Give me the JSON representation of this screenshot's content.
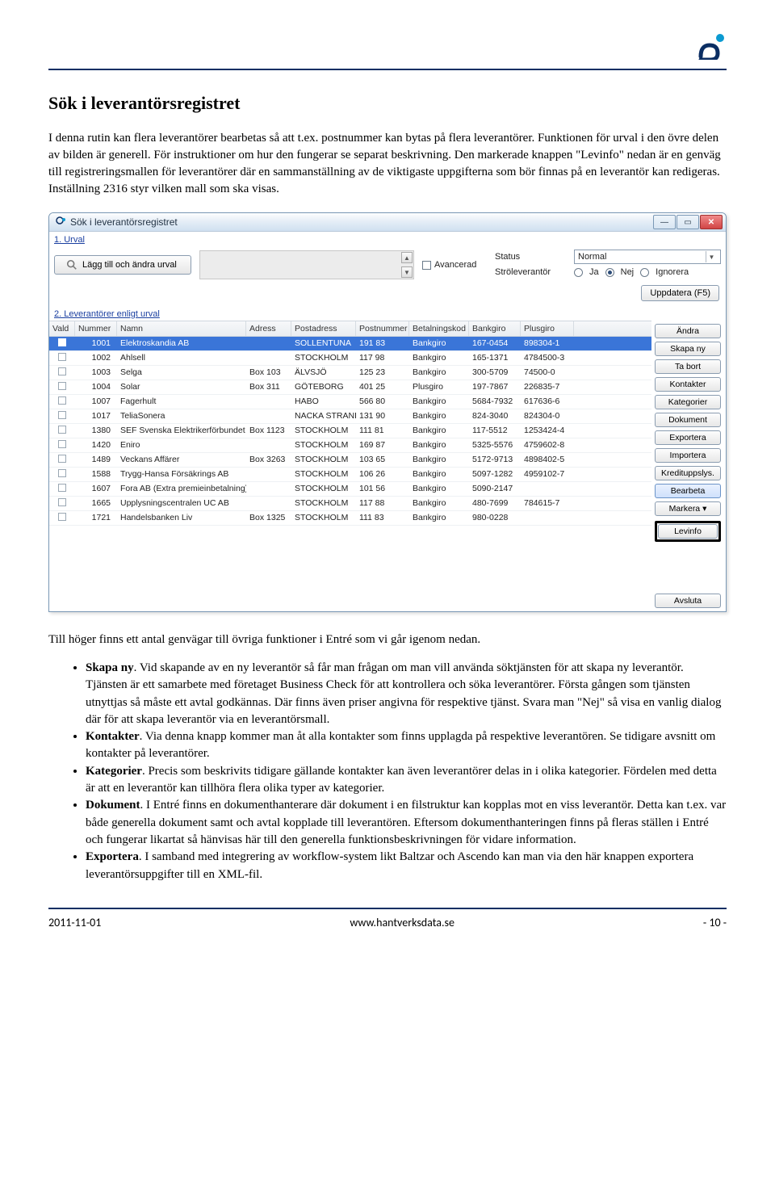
{
  "doc": {
    "section_title": "Sök i leverantörsregistret",
    "para1": "I denna rutin  kan flera leverantörer bearbetas så att t.ex. postnummer kan bytas på flera leverantörer. Funktionen för urval i den övre delen av bilden är generell. För instruktioner om hur den fungerar se separat beskrivning. Den markerade knappen \"Levinfo\" nedan är en genväg till registreringsmallen för leverantörer där en sammanställning av de viktigaste uppgifterna som bör finnas på en leverantör kan redigeras. Inställning 2316 styr vilken mall som ska visas.",
    "para2": "Till höger finns ett antal genvägar till övriga funktioner i Entré som vi går igenom nedan.",
    "bullets": [
      {
        "lead": "Skapa ny",
        "text": ". Vid skapande av en ny leverantör så får man frågan om man vill använda söktjänsten för att skapa ny leverantör. Tjänsten är ett samarbete med företaget Business Check för att kontrollera och söka leverantörer. Första gången som tjänsten utnyttjas så måste ett avtal godkännas. Där finns även priser angivna för respektive tjänst. Svara man \"Nej\" så visa en vanlig dialog där för att skapa leverantör via en leverantörsmall."
      },
      {
        "lead": "Kontakter",
        "text": ". Via denna knapp kommer man åt alla kontakter som finns upplagda på respektive leverantören. Se tidigare avsnitt om kontakter på leverantörer."
      },
      {
        "lead": "Kategorier",
        "text": ". Precis som beskrivits tidigare gällande kontakter kan även leverantörer delas in i olika kategorier. Fördelen med detta är att en leverantör kan tillhöra flera olika typer av kategorier."
      },
      {
        "lead": "Dokument",
        "text": ". I Entré finns en dokumenthanterare där dokument i en filstruktur kan kopplas mot en viss leverantör. Detta kan t.ex. var både generella dokument samt och avtal kopplade till leverantören.  Eftersom dokumenthanteringen finns på fleras ställen i Entré och fungerar likartat så hänvisas här till den generella funktionsbeskrivningen för vidare information."
      },
      {
        "lead": "Exportera",
        "text": ". I samband med integrering av workflow-system likt Baltzar och Ascendo kan man via den här knappen exportera leverantörsuppgifter till en XML-fil."
      }
    ]
  },
  "app": {
    "window_title": "Sök i leverantörsregistret",
    "urval_header": "1. Urval",
    "add_urval_button": "Lägg till och ändra urval",
    "advanced_label": "Avancerad",
    "status_label": "Status",
    "status_value": "Normal",
    "strolev_label": "Ströleverantör",
    "radio_ja": "Ja",
    "radio_nej": "Nej",
    "radio_ignorera": "Ignorera",
    "update_button": "Uppdatera (F5)",
    "list_header": "2. Leverantörer enligt urval",
    "columns": [
      "Vald",
      "Nummer",
      "Namn",
      "Adress",
      "Postadress",
      "Postnummer",
      "Betalningskod",
      "Bankgiro",
      "Plusgiro"
    ],
    "rows": [
      {
        "nummer": "1001",
        "namn": "Elektroskandia AB",
        "adress": "",
        "postadress": "SOLLENTUNA",
        "postnummer": "191 83",
        "betalningskod": "Bankgiro",
        "bankgiro": "167-0454",
        "plusgiro": "898304-1",
        "selected": true
      },
      {
        "nummer": "1002",
        "namn": "Ahlsell",
        "adress": "",
        "postadress": "STOCKHOLM",
        "postnummer": "117 98",
        "betalningskod": "Bankgiro",
        "bankgiro": "165-1371",
        "plusgiro": "4784500-3"
      },
      {
        "nummer": "1003",
        "namn": "Selga",
        "adress": "Box 103",
        "postadress": "ÄLVSJÖ",
        "postnummer": "125 23",
        "betalningskod": "Bankgiro",
        "bankgiro": "300-5709",
        "plusgiro": "74500-0"
      },
      {
        "nummer": "1004",
        "namn": "Solar",
        "adress": "Box 311",
        "postadress": "GÖTEBORG",
        "postnummer": "401 25",
        "betalningskod": "Plusgiro",
        "bankgiro": "197-7867",
        "plusgiro": "226835-7"
      },
      {
        "nummer": "1007",
        "namn": "Fagerhult",
        "adress": "",
        "postadress": "HABO",
        "postnummer": "566 80",
        "betalningskod": "Bankgiro",
        "bankgiro": "5684-7932",
        "plusgiro": "617636-6"
      },
      {
        "nummer": "1017",
        "namn": "TeliaSonera",
        "adress": "",
        "postadress": "NACKA STRAND",
        "postnummer": "131 90",
        "betalningskod": "Bankgiro",
        "bankgiro": "824-3040",
        "plusgiro": "824304-0"
      },
      {
        "nummer": "1380",
        "namn": "SEF Svenska Elektrikerförbundet",
        "adress": "Box 1123",
        "postadress": "STOCKHOLM",
        "postnummer": "111 81",
        "betalningskod": "Bankgiro",
        "bankgiro": "117-5512",
        "plusgiro": "1253424-4"
      },
      {
        "nummer": "1420",
        "namn": "Eniro",
        "adress": "",
        "postadress": "STOCKHOLM",
        "postnummer": "169 87",
        "betalningskod": "Bankgiro",
        "bankgiro": "5325-5576",
        "plusgiro": "4759602-8"
      },
      {
        "nummer": "1489",
        "namn": "Veckans Affärer",
        "adress": "Box 3263",
        "postadress": "STOCKHOLM",
        "postnummer": "103 65",
        "betalningskod": "Bankgiro",
        "bankgiro": "5172-9713",
        "plusgiro": "4898402-5"
      },
      {
        "nummer": "1588",
        "namn": "Trygg-Hansa Försäkrings AB",
        "adress": "",
        "postadress": "STOCKHOLM",
        "postnummer": "106 26",
        "betalningskod": "Bankgiro",
        "bankgiro": "5097-1282",
        "plusgiro": "4959102-7"
      },
      {
        "nummer": "1607",
        "namn": "Fora AB (Extra premieinbetalning)",
        "adress": "",
        "postadress": "STOCKHOLM",
        "postnummer": "101 56",
        "betalningskod": "Bankgiro",
        "bankgiro": "5090-2147",
        "plusgiro": ""
      },
      {
        "nummer": "1665",
        "namn": "Upplysningscentralen UC AB",
        "adress": "",
        "postadress": "STOCKHOLM",
        "postnummer": "117 88",
        "betalningskod": "Bankgiro",
        "bankgiro": "480-7699",
        "plusgiro": "784615-7"
      },
      {
        "nummer": "1721",
        "namn": "Handelsbanken Liv",
        "adress": "Box 1325",
        "postadress": "STOCKHOLM",
        "postnummer": "111 83",
        "betalningskod": "Bankgiro",
        "bankgiro": "980-0228",
        "plusgiro": ""
      }
    ],
    "side": {
      "andra": "Ändra",
      "skapa_ny": "Skapa ny",
      "ta_bort": "Ta bort",
      "kontakter": "Kontakter",
      "kategorier": "Kategorier",
      "dokument": "Dokument",
      "exportera": "Exportera",
      "importera": "Importera",
      "kredituppl": "Kredituppslys.",
      "bearbeta": "Bearbeta",
      "markera": "Markera  ▾",
      "levinfo": "Levinfo",
      "avsluta": "Avsluta"
    }
  },
  "footer": {
    "date": "2011-11-01",
    "site": "www.hantverksdata.se",
    "page": "- 10 -"
  }
}
